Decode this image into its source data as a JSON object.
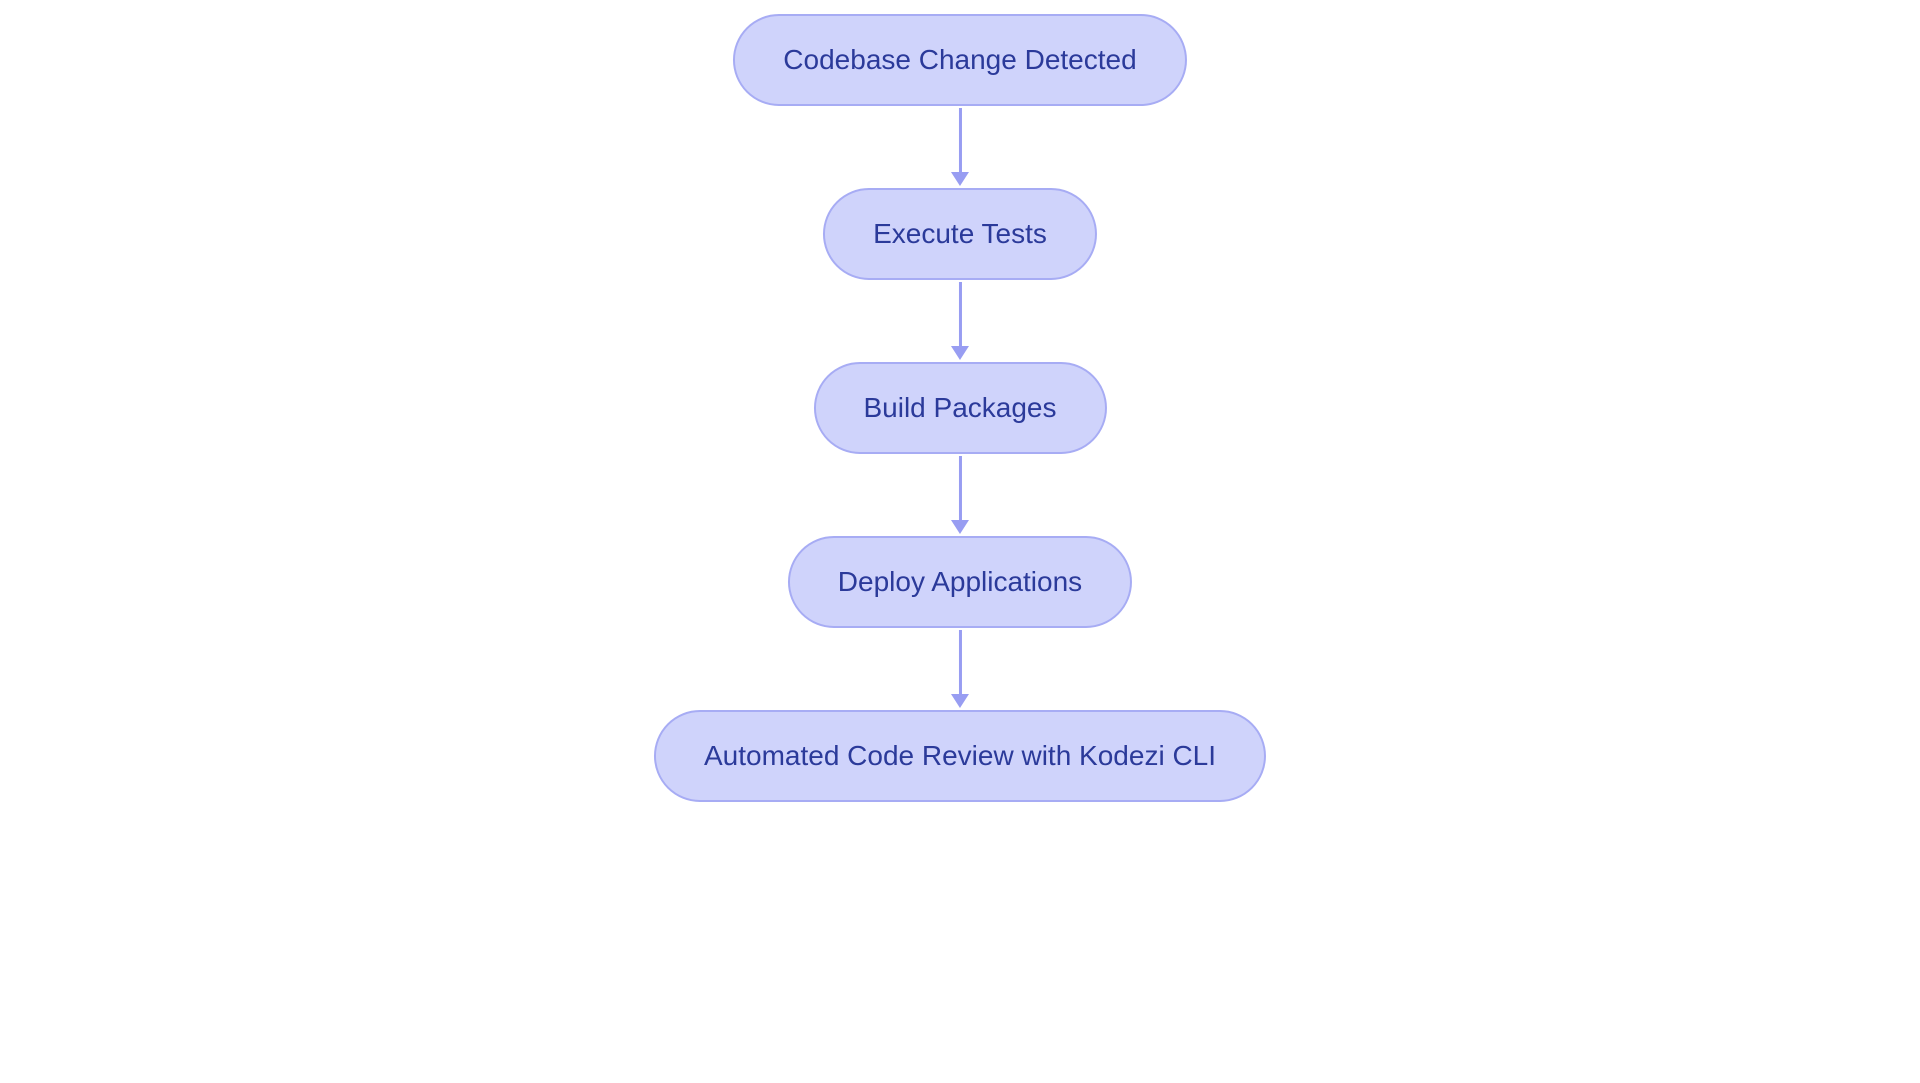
{
  "flowchart": {
    "nodes": [
      {
        "label": "Codebase Change Detected"
      },
      {
        "label": "Execute Tests"
      },
      {
        "label": "Build Packages"
      },
      {
        "label": "Deploy Applications"
      },
      {
        "label": "Automated Code Review with Kodezi CLI"
      }
    ]
  }
}
